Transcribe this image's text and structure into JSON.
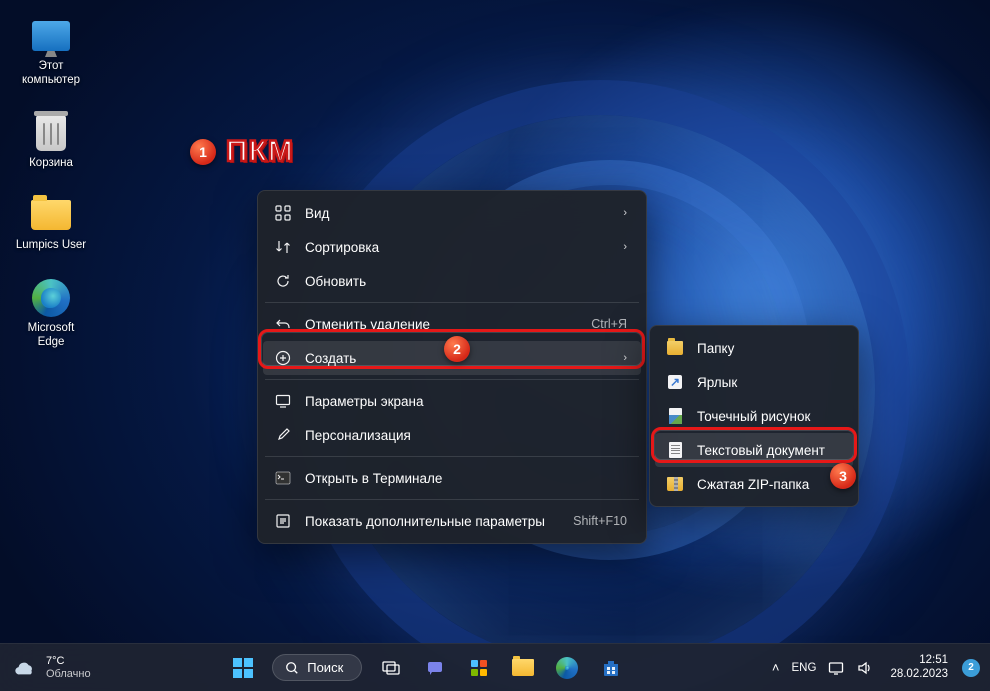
{
  "desktop_icons": {
    "this_pc": "Этот\nкомпьютер",
    "recycle_bin": "Корзина",
    "user_folder": "Lumpics User",
    "edge": "Microsoft Edge"
  },
  "callout1": "ПКМ",
  "context_menu": {
    "view": "Вид",
    "sort": "Сортировка",
    "refresh": "Обновить",
    "undo_delete": "Отменить удаление",
    "undo_shortcut": "Ctrl+Я",
    "new": "Создать",
    "display_settings": "Параметры экрана",
    "personalize": "Персонализация",
    "open_terminal": "Открыть в Терминале",
    "more_options": "Показать дополнительные параметры",
    "more_shortcut": "Shift+F10"
  },
  "submenu": {
    "folder": "Папку",
    "shortcut": "Ярлык",
    "bitmap": "Точечный рисунок",
    "text_doc": "Текстовый документ",
    "zip": "Сжатая ZIP-папка"
  },
  "taskbar": {
    "temp": "7°C",
    "weather": "Облачно",
    "search": "Поиск",
    "lang": "ENG",
    "time": "12:51",
    "date": "28.02.2023",
    "notif_count": "2"
  }
}
